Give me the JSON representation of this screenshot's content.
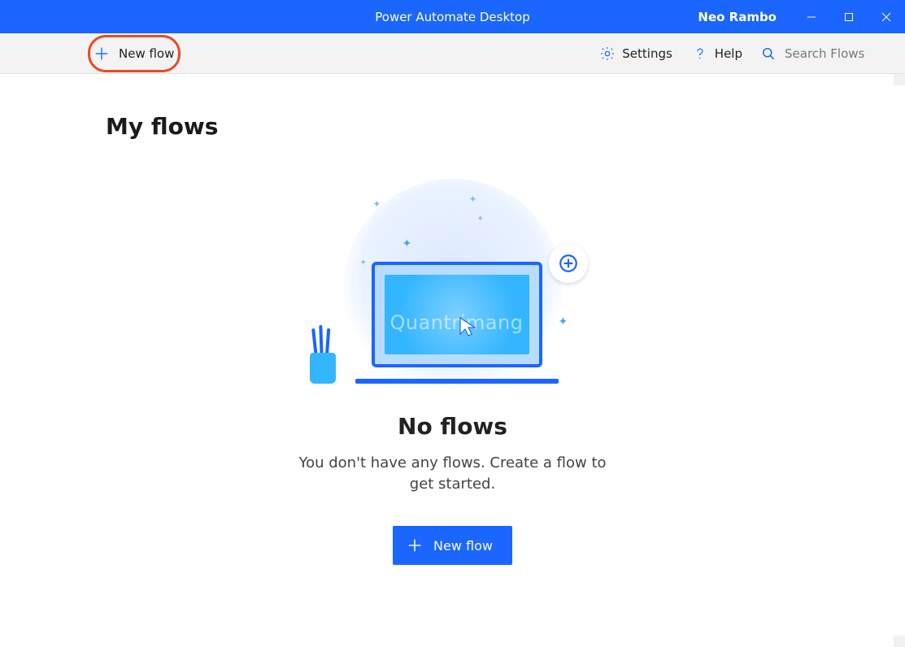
{
  "titlebar": {
    "app_title": "Power Automate Desktop",
    "user_name": "Neo Rambo"
  },
  "commandbar": {
    "new_flow_label": "New flow",
    "settings_label": "Settings",
    "help_label": "Help",
    "search_placeholder": "Search Flows"
  },
  "main": {
    "heading": "My flows",
    "empty_state": {
      "title": "No flows",
      "subtitle": "You don't have any flows. Create a flow to get started.",
      "button_label": "New flow"
    },
    "watermark": "Quantrimang"
  }
}
